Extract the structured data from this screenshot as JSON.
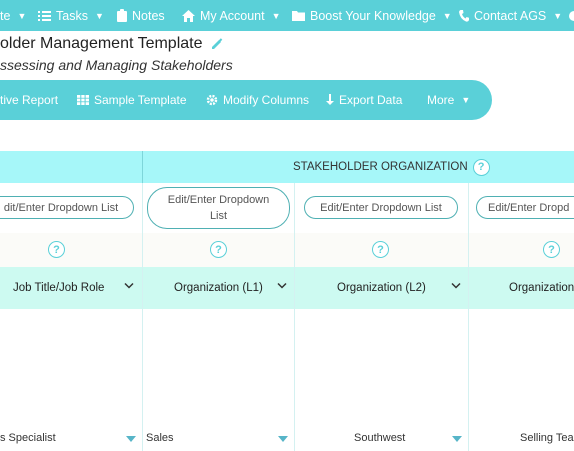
{
  "nav": {
    "items": [
      {
        "label": "te"
      },
      {
        "label": "Tasks"
      },
      {
        "label": "Notes"
      },
      {
        "label": "My Account"
      },
      {
        "label": "Boost Your Knowledge"
      },
      {
        "label": "Contact AGS"
      }
    ]
  },
  "page": {
    "title": "older Management Template",
    "subtitle": "ssessing and Managing Stakeholders"
  },
  "toolbar": {
    "report_label": "tive Report",
    "sample_label": "Sample Template",
    "modify_label": "Modify Columns",
    "export_label": "Export Data",
    "more_label": "More"
  },
  "grid": {
    "group_title": "STAKEHOLDER ORGANIZATION",
    "help_glyph": "?",
    "dropdown_btn_a": "dit/Enter Dropdown List",
    "dropdown_btn_b_line1": "Edit/Enter Dropdown",
    "dropdown_btn_b_line2": "List",
    "dropdown_btn_c": "Edit/Enter Dropdown List",
    "dropdown_btn_d": "Edit/Enter Dropd",
    "columns": [
      {
        "label": "Job Title/Job Role"
      },
      {
        "label": "Organization (L1)"
      },
      {
        "label": "Organization (L2)"
      },
      {
        "label": "Organization"
      }
    ],
    "row": {
      "c1": "s Specialist",
      "c2": "Sales",
      "c3": "Southwest",
      "c4": "Selling Tea"
    }
  },
  "colors": {
    "accent": "#5ad0d8",
    "header_band": "#a6f7f9",
    "column_header": "#cdfaf1"
  }
}
